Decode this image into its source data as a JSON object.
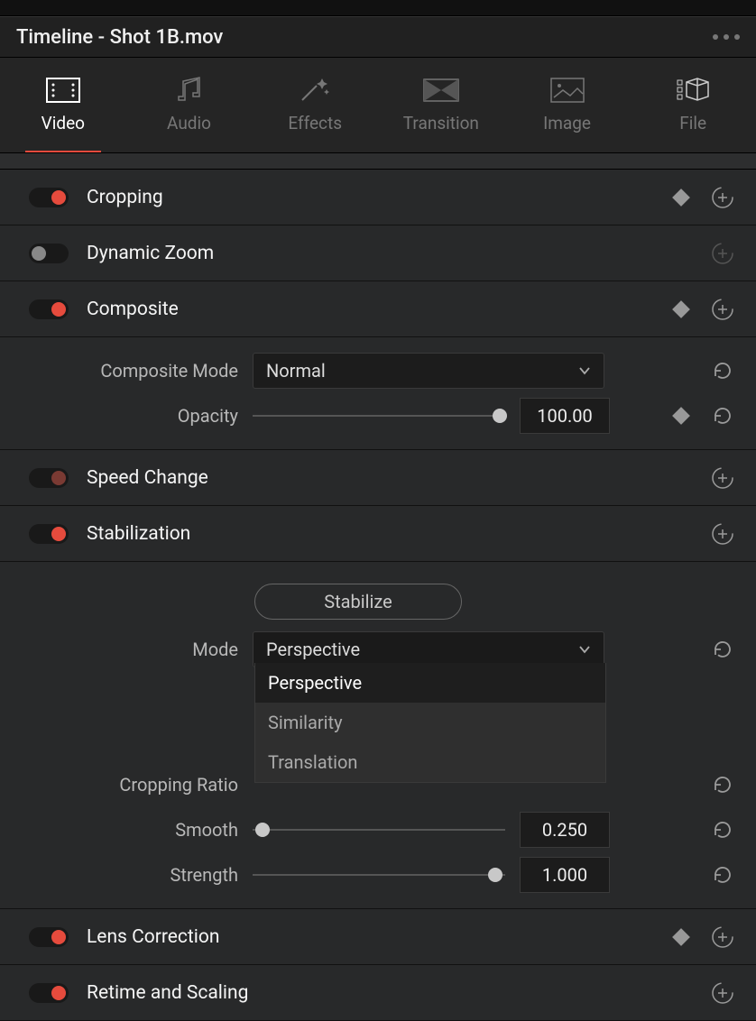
{
  "title": "Timeline - Shot 1B.mov",
  "tabs": {
    "video": "Video",
    "audio": "Audio",
    "effects": "Effects",
    "transition": "Transition",
    "image": "Image",
    "file": "File"
  },
  "sections": {
    "cropping": {
      "title": "Cropping"
    },
    "dynamic_zoom": {
      "title": "Dynamic Zoom"
    },
    "composite": {
      "title": "Composite",
      "mode_label": "Composite Mode",
      "mode_value": "Normal",
      "opacity_label": "Opacity",
      "opacity_value": "100.00"
    },
    "speed_change": {
      "title": "Speed Change"
    },
    "stabilization": {
      "title": "Stabilization",
      "button": "Stabilize",
      "mode_label": "Mode",
      "mode_value": "Perspective",
      "mode_options": [
        "Perspective",
        "Similarity",
        "Translation"
      ],
      "cropping_ratio_label": "Cropping Ratio",
      "smooth_label": "Smooth",
      "smooth_value": "0.250",
      "strength_label": "Strength",
      "strength_value": "1.000"
    },
    "lens_correction": {
      "title": "Lens Correction"
    },
    "retime_scaling": {
      "title": "Retime and Scaling"
    }
  }
}
